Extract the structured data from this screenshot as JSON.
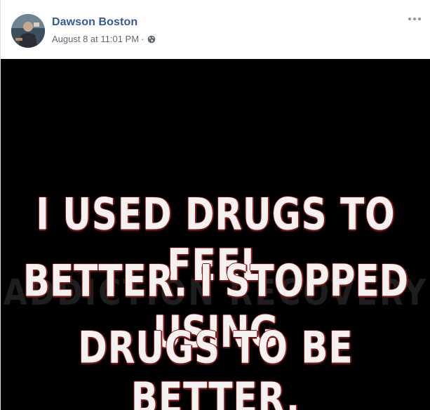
{
  "post": {
    "author_name": "Dawson Boston",
    "timestamp": "August 8 at 11:01 PM",
    "separator": "·",
    "privacy_icon": "globe-icon",
    "more_icon": "more-options-icon"
  },
  "image": {
    "quote_lines": [
      "I USED DRUGS TO FEEL",
      "BETTER. I STOPPED USING",
      "DRUGS TO BE BETTER."
    ],
    "watermark": "ADDICTION RECOVERY"
  },
  "colors": {
    "author_link": "#365899",
    "meta_text": "#616770",
    "image_background": "#000000",
    "quote_text": "#f4f1f1",
    "quote_outline": "#8e1a1a"
  }
}
